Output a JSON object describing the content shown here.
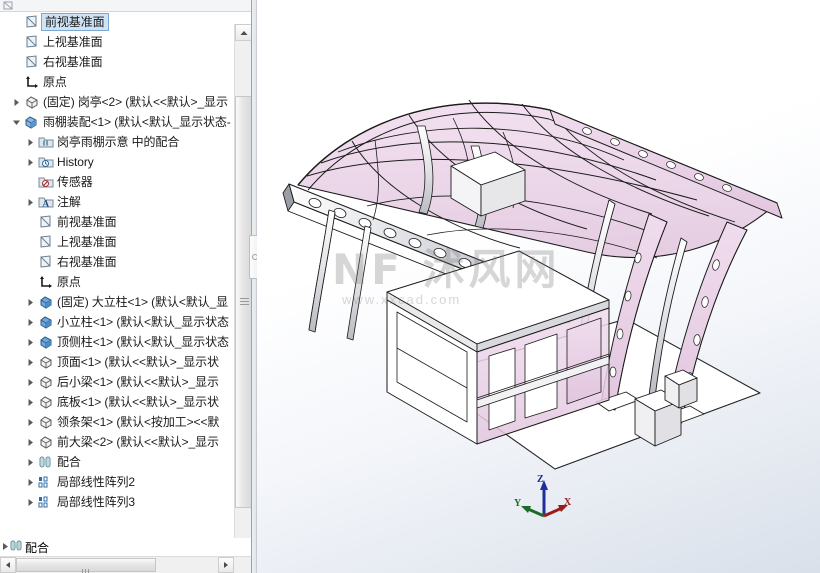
{
  "app": {
    "kind": "cad-assembly-viewer",
    "accent": "#cfe3f5",
    "model_face_color": "#e8cfe4",
    "model_edge_color": "#1a1a1a",
    "viewport_bg_top": "#ffffff",
    "viewport_bg_bottom": "#d9e0ea"
  },
  "tree": {
    "panel_name": "FeatureManager design tree",
    "selected_index": 0,
    "items": [
      {
        "label": "前视基准面",
        "icon": "plane-icon",
        "indent": 1,
        "expander": false,
        "selected": true
      },
      {
        "label": "上视基准面",
        "icon": "plane-icon",
        "indent": 1,
        "expander": false,
        "selected": false
      },
      {
        "label": "右视基准面",
        "icon": "plane-icon",
        "indent": 1,
        "expander": false,
        "selected": false
      },
      {
        "label": "原点",
        "icon": "origin-icon",
        "indent": 1,
        "expander": false,
        "selected": false
      },
      {
        "label": "(固定) 岗亭<2> (默认<<默认>_显示",
        "icon": "part-gray-icon",
        "indent": 0,
        "expander": true,
        "selected": false
      },
      {
        "label": "雨棚装配<1> (默认<默认_显示状态-",
        "icon": "assembly-blue-icon",
        "indent": 0,
        "expander": true,
        "expanded": true,
        "selected": false
      },
      {
        "label": "岗亭雨棚示意 中的配合",
        "icon": "mates-folder-icon",
        "indent": 2,
        "expander": true,
        "selected": false
      },
      {
        "label": "History",
        "icon": "history-folder-icon",
        "indent": 2,
        "expander": true,
        "selected": false
      },
      {
        "label": "传感器",
        "icon": "sensor-folder-icon",
        "indent": 2,
        "expander": false,
        "selected": false
      },
      {
        "label": "注解",
        "icon": "annotations-folder-icon",
        "indent": 2,
        "expander": true,
        "selected": false
      },
      {
        "label": "前视基准面",
        "icon": "plane-icon",
        "indent": 3,
        "expander": false,
        "selected": false
      },
      {
        "label": "上视基准面",
        "icon": "plane-icon",
        "indent": 3,
        "expander": false,
        "selected": false
      },
      {
        "label": "右视基准面",
        "icon": "plane-icon",
        "indent": 3,
        "expander": false,
        "selected": false
      },
      {
        "label": "原点",
        "icon": "origin-icon",
        "indent": 3,
        "expander": false,
        "selected": false
      },
      {
        "label": "(固定) 大立柱<1> (默认<默认_显",
        "icon": "part-blue-icon",
        "indent": 2,
        "expander": true,
        "selected": false
      },
      {
        "label": "小立柱<1> (默认<默认_显示状态",
        "icon": "part-blue-icon",
        "indent": 2,
        "expander": true,
        "selected": false
      },
      {
        "label": "顶侧柱<1> (默认<默认_显示状态",
        "icon": "part-blue-icon",
        "indent": 2,
        "expander": true,
        "selected": false
      },
      {
        "label": "顶面<1> (默认<<默认>_显示状",
        "icon": "part-gray-icon",
        "indent": 2,
        "expander": true,
        "selected": false
      },
      {
        "label": "后小梁<1> (默认<<默认>_显示",
        "icon": "part-gray-icon",
        "indent": 2,
        "expander": true,
        "selected": false
      },
      {
        "label": "底板<1> (默认<<默认>_显示状",
        "icon": "part-gray-icon",
        "indent": 2,
        "expander": true,
        "selected": false
      },
      {
        "label": "领条架<1> (默认<按加工><<默",
        "icon": "part-gray-icon",
        "indent": 2,
        "expander": true,
        "selected": false
      },
      {
        "label": "前大梁<2> (默认<<默认>_显示",
        "icon": "part-gray-icon",
        "indent": 2,
        "expander": true,
        "selected": false
      },
      {
        "label": "配合",
        "icon": "mates-icon",
        "indent": 2,
        "expander": true,
        "selected": false
      },
      {
        "label": "局部线性阵列2",
        "icon": "linear-pattern-icon",
        "indent": 2,
        "expander": true,
        "selected": false
      },
      {
        "label": "局部线性阵列3",
        "icon": "linear-pattern-icon",
        "indent": 2,
        "expander": true,
        "selected": false
      }
    ],
    "bottom_item": {
      "label": "配合",
      "icon": "mates-icon",
      "expander": true
    }
  },
  "scrollbars": {
    "vertical_up_arrow": "▲",
    "vertical_down_arrow": "▼",
    "horizontal_left_arrow": "◀",
    "horizontal_right_arrow": "▶"
  },
  "viewport": {
    "name": "graphics-area",
    "watermark_main": "NF 沭风网",
    "watermark_sub": "www.xxcad.com",
    "triad": {
      "x_label": "X",
      "y_label": "Y",
      "z_label": "Z",
      "x_color": "#9b1b1b",
      "y_color": "#1d6b2a",
      "z_color": "#1e2f9b"
    }
  }
}
